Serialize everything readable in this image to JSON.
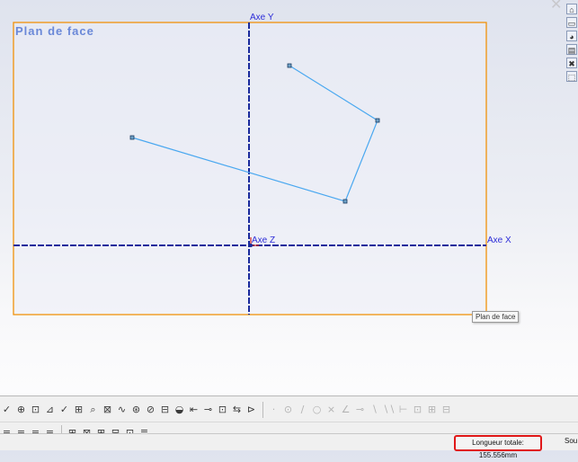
{
  "viewport": {
    "plane_title": "Plan de face",
    "axis_y_label": "Axe Y",
    "axis_x_label": "Axe X",
    "axis_z_label": "Axe Z",
    "tooltip": "Plan de face",
    "close_glyph": "✕"
  },
  "taskpane": {
    "icons": [
      "home-icon",
      "folder-icon",
      "appearance-icon",
      "property-icon",
      "close-icon",
      "part-icon"
    ],
    "glyphs": [
      "⌂",
      "▭",
      "◕",
      "▤",
      "✖",
      "⬚"
    ]
  },
  "toolbar": {
    "row1": [
      "✓",
      "⊕",
      "⊡",
      "⊿",
      "✓",
      "⊞",
      "⌕",
      "⊠",
      "∿",
      "⊛",
      "⊘",
      "⊟",
      "◒",
      "⇤",
      "⊸",
      "⊡",
      "⇆",
      "⊳",
      "·",
      "⊙",
      "∕",
      "○",
      "⨯",
      "∠",
      "⊸",
      "∖",
      "∖∖",
      "⊢",
      "⊡",
      "⊞",
      "⊟"
    ],
    "row2": [
      "≡",
      "≡",
      "≡",
      "≡",
      "⊞",
      "⊠",
      "⊞",
      "⊟",
      "⊡",
      "≣"
    ]
  },
  "status": {
    "total_length": "Longueur totale: 155.556mm",
    "extra": "Sou"
  },
  "colors": {
    "plane_border": "#f0920a",
    "sketch_line": "#4aa8f0",
    "axis": "#1a2a9c",
    "status_highlight": "#e01818"
  }
}
